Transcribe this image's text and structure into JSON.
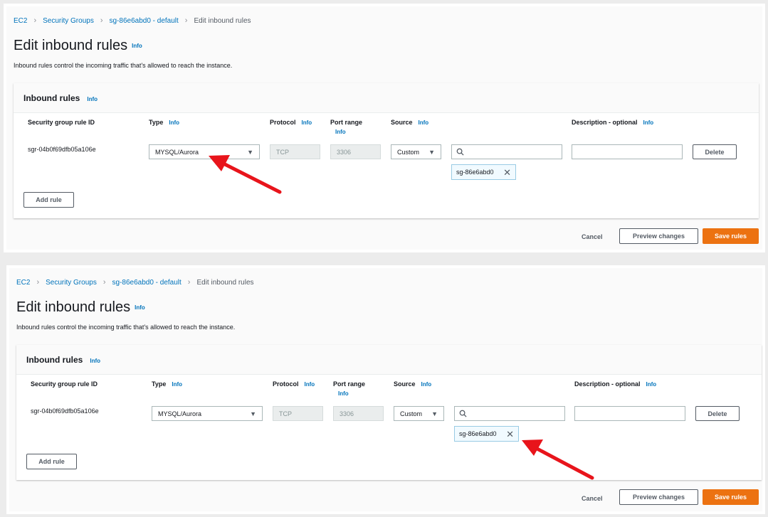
{
  "screens": [
    {
      "breadcrumb": [
        "EC2",
        "Security Groups",
        "sg-86e6abd0 - default",
        "Edit inbound rules"
      ],
      "title": "Edit inbound rules",
      "info": "Info",
      "description": "Inbound rules control the incoming traffic that's allowed to reach the instance.",
      "card_title": "Inbound rules",
      "columns": {
        "rule_id": "Security group rule ID",
        "type": "Type",
        "protocol": "Protocol",
        "port_range": "Port range",
        "source": "Source",
        "description": "Description - optional"
      },
      "rule": {
        "id": "sgr-04b0f69dfb05a106e",
        "type": "MYSQL/Aurora",
        "protocol": "TCP",
        "port": "3306",
        "source": "Custom",
        "search_value": "",
        "token": "sg-86e6abd0",
        "description_value": "",
        "delete_label": "Delete"
      },
      "add_rule_label": "Add rule",
      "footer": {
        "cancel": "Cancel",
        "preview": "Preview changes",
        "save": "Save rules"
      }
    },
    {
      "breadcrumb": [
        "EC2",
        "Security Groups",
        "sg-86e6abd0 - default",
        "Edit inbound rules"
      ],
      "title": "Edit inbound rules",
      "info": "Info",
      "description": "Inbound rules control the incoming traffic that's allowed to reach the instance.",
      "card_title": "Inbound rules",
      "columns": {
        "rule_id": "Security group rule ID",
        "type": "Type",
        "protocol": "Protocol",
        "port_range": "Port range",
        "source": "Source",
        "description": "Description - optional"
      },
      "rule": {
        "id": "sgr-04b0f69dfb05a106e",
        "type": "MYSQL/Aurora",
        "protocol": "TCP",
        "port": "3306",
        "source": "Custom",
        "search_value": "",
        "token": "sg-86e6abd0",
        "description_value": "",
        "delete_label": "Delete"
      },
      "add_rule_label": "Add rule",
      "footer": {
        "cancel": "Cancel",
        "preview": "Preview changes",
        "save": "Save rules"
      }
    }
  ],
  "colors": {
    "accent": "#ec7211",
    "link": "#0073bb",
    "annotation_arrow": "#e8141b"
  },
  "icons": [
    "chevron-right-icon",
    "caret-down-icon",
    "search-icon",
    "close-icon",
    "red-arrow-annotation"
  ]
}
